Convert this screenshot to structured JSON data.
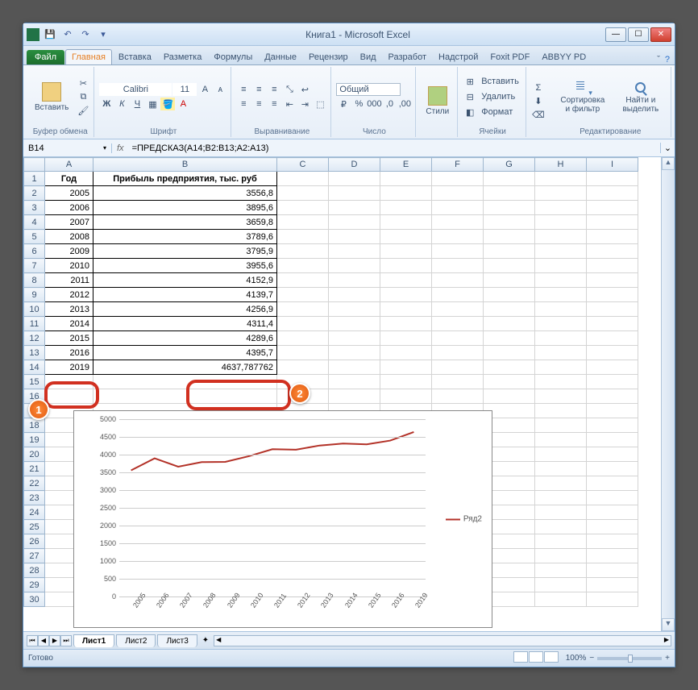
{
  "window": {
    "title": "Книга1 - Microsoft Excel"
  },
  "tabs": {
    "file": "Файл",
    "items": [
      "Главная",
      "Вставка",
      "Разметка",
      "Формулы",
      "Данные",
      "Рецензир",
      "Вид",
      "Разработ",
      "Надстрой",
      "Foxit PDF",
      "ABBYY PD"
    ],
    "active": 0
  },
  "ribbon": {
    "clipboard": {
      "paste": "Вставить",
      "label": "Буфер обмена"
    },
    "font": {
      "name": "Calibri",
      "size": "11",
      "label": "Шрифт"
    },
    "alignment": {
      "label": "Выравнивание"
    },
    "number": {
      "format": "Общий",
      "label": "Число"
    },
    "styles": {
      "btn": "Стили",
      "label": ""
    },
    "cells": {
      "insert": "Вставить",
      "delete": "Удалить",
      "format": "Формат",
      "label": "Ячейки"
    },
    "editing": {
      "sort": "Сортировка и фильтр",
      "find": "Найти и выделить",
      "label": "Редактирование"
    }
  },
  "formula_bar": {
    "cell": "B14",
    "formula": "=ПРЕДСКАЗ(A14;B2:B13;A2:A13)"
  },
  "table": {
    "headers": {
      "year": "Год",
      "profit": "Прибыль предприятия, тыс. руб"
    },
    "rows": [
      {
        "year": "2005",
        "profit": "3556,8"
      },
      {
        "year": "2006",
        "profit": "3895,6"
      },
      {
        "year": "2007",
        "profit": "3659,8"
      },
      {
        "year": "2008",
        "profit": "3789,6"
      },
      {
        "year": "2009",
        "profit": "3795,9"
      },
      {
        "year": "2010",
        "profit": "3955,6"
      },
      {
        "year": "2011",
        "profit": "4152,9"
      },
      {
        "year": "2012",
        "profit": "4139,7"
      },
      {
        "year": "2013",
        "profit": "4256,9"
      },
      {
        "year": "2014",
        "profit": "4311,4"
      },
      {
        "year": "2015",
        "profit": "4289,6"
      },
      {
        "year": "2016",
        "profit": "4395,7"
      },
      {
        "year": "2019",
        "profit": "4637,787762"
      }
    ]
  },
  "columns": [
    "A",
    "B",
    "C",
    "D",
    "E",
    "F",
    "G",
    "H",
    "I"
  ],
  "markers": {
    "m1": "1",
    "m2": "2"
  },
  "chart_data": {
    "type": "line",
    "title": "",
    "xlabel": "",
    "ylabel": "",
    "ylim": [
      0,
      5000
    ],
    "yticks": [
      0,
      500,
      1000,
      1500,
      2000,
      2500,
      3000,
      3500,
      4000,
      4500,
      5000
    ],
    "categories": [
      "2005",
      "2006",
      "2007",
      "2008",
      "2009",
      "2010",
      "2011",
      "2012",
      "2013",
      "2014",
      "2015",
      "2016",
      "2019"
    ],
    "series": [
      {
        "name": "Ряд2",
        "color": "#b33228",
        "values": [
          3556.8,
          3895.6,
          3659.8,
          3789.6,
          3795.9,
          3955.6,
          4152.9,
          4139.7,
          4256.9,
          4311.4,
          4289.6,
          4395.7,
          4637.8
        ]
      }
    ]
  },
  "sheets": {
    "items": [
      "Лист1",
      "Лист2",
      "Лист3"
    ],
    "active": 0
  },
  "status": {
    "ready": "Готово",
    "zoom": "100%"
  }
}
